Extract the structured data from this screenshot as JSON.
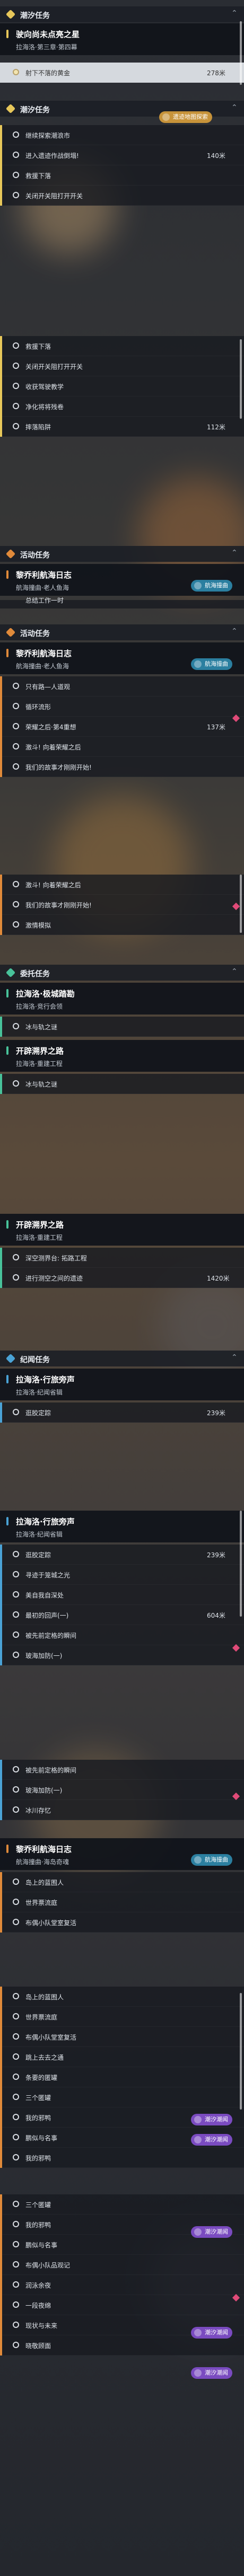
{
  "colors": {
    "tide": "#e7c75a",
    "event": "#e08a3a",
    "rich": "#48c29a",
    "legend": "#4aa3d6",
    "tag_navy": "#2b7fa0",
    "tag_purple": "#7a4bc0",
    "tag_gold": "#c7933a"
  },
  "icons": {
    "section": "diamond-icon",
    "quest": "circle-icon",
    "tag": "wave-icon",
    "chevron": "chevron-up-icon"
  },
  "sections": {
    "s1_tide": "潮汐任务",
    "s1_card_title": "驶向尚未点亮之星",
    "s1_card_sub": "拉海洛·第三章·第四幕",
    "s1_sel_label": "射下不落的黄金",
    "s1_sel_dist": "278米",
    "s2_hdr": "潮汐任务",
    "s2_tag": "遗迹地图探索",
    "s2_items": [
      {
        "label": "继续探索潮浪市",
        "dist": ""
      },
      {
        "label": "进入遗迹作战倒塌!",
        "dist": "140米"
      },
      {
        "label": "救援下落",
        "dist": ""
      },
      {
        "label": "关闭开关阻打开开关",
        "dist": ""
      }
    ],
    "s3_items": [
      {
        "label": "救援下落",
        "dist": ""
      },
      {
        "label": "关闭开关阻打开开关",
        "dist": ""
      },
      {
        "label": "收获驾驶教学",
        "dist": ""
      },
      {
        "label": "净化将将残卷",
        "dist": ""
      },
      {
        "label": "摔落陷阱",
        "dist": "112米"
      }
    ],
    "s4_hdr": "活动任务",
    "s4_card_title": "黎乔利航海日志",
    "s4_card_sub": "航海撞曲·老人鱼海",
    "s4_tag": "航海撞曲",
    "s4_partial": "总结工作一时",
    "s5_hdr": "活动任务",
    "s5_card_title": "黎乔利航海日志",
    "s5_card_sub": "航海撞曲·老人鱼海",
    "s5_tag": "航海撞曲",
    "s5_items": [
      {
        "label": "只有路—人道观",
        "dist": ""
      },
      {
        "label": "循环流形",
        "dist": ""
      },
      {
        "label": "荣耀之后·第4重想",
        "dist": "137米"
      },
      {
        "label": "激斗! 向着荣耀之后",
        "dist": ""
      },
      {
        "label": "我们的故事才刚刚开始!",
        "dist": ""
      }
    ],
    "s6_items": [
      {
        "label": "激斗! 向着荣耀之后",
        "dist": ""
      },
      {
        "label": "我们的故事才刚刚开始!",
        "dist": ""
      },
      {
        "label": "激情模拟",
        "dist": ""
      }
    ],
    "s7_hdr": "委托任务",
    "s7_card1_title": "拉海洛·极城踏勘",
    "s7_card1_sub": "拉海洛·竞行会领",
    "s7_items1": [
      {
        "label": "冰与轨之谜",
        "dist": ""
      }
    ],
    "s7_card2_title": "开辟溯界之路",
    "s7_card2_sub": "拉海洛·重建工程",
    "s7_items2": [
      {
        "label": "冰与轨之谜",
        "dist": ""
      }
    ],
    "s8_card_title": "开辟溯界之路",
    "s8_card_sub": "拉海洛·重建工程",
    "s8_items": [
      {
        "label": "深空测界台: 拓路工程",
        "dist": ""
      },
      {
        "label": "进行测空之间的遗迹",
        "dist": "1420米"
      }
    ],
    "s9_hdr": "纪闻任务",
    "s9_card_title": "拉海洛·行旅旁声",
    "s9_card_sub": "拉海洛·纪闻省辑",
    "s9_items": [
      {
        "label": "逛胶定踪",
        "dist": "239米"
      }
    ],
    "s10_card_title": "拉海洛·行旅旁声",
    "s10_card_sub": "拉海洛·纪闻省辑",
    "s10_items": [
      {
        "label": "逛胶定踪",
        "dist": "239米"
      },
      {
        "label": "寻迹于笼城之光",
        "dist": ""
      },
      {
        "label": "美自我自深处",
        "dist": ""
      },
      {
        "label": "最初的回声(一)",
        "dist": "604米"
      },
      {
        "label": "被先前定格的瞬间",
        "dist": ""
      },
      {
        "label": "玻海加防(一)",
        "dist": ""
      }
    ],
    "s11_items": [
      {
        "label": "被先前定格的瞬间",
        "dist": ""
      },
      {
        "label": "玻海加防(一)",
        "dist": ""
      },
      {
        "label": "冰川存忆",
        "dist": ""
      }
    ],
    "s12_card_title": "黎乔利航海日志",
    "s12_card_sub": "航海撞曲·海岛奇魂",
    "s12_tag": "航海撞曲",
    "s12_items": [
      {
        "label": "岛上的蓝囿人",
        "dist": ""
      },
      {
        "label": "世界票流庭",
        "dist": ""
      },
      {
        "label": "布偶小队堂室复活",
        "dist": ""
      }
    ],
    "s13_items": [
      {
        "label": "岛上的蓝囿人",
        "dist": ""
      },
      {
        "label": "世界票流庭",
        "dist": ""
      },
      {
        "label": "布偶小队堂室复活",
        "dist": ""
      },
      {
        "label": "跳上去去之通",
        "dist": ""
      },
      {
        "label": "条要的匿罐",
        "dist": ""
      },
      {
        "label": "三个匿罐",
        "dist": ""
      },
      {
        "label": "我的邪鸭",
        "dist": ""
      },
      {
        "label": "鹏似与名事",
        "dist": ""
      },
      {
        "label": "我的邪鸭",
        "dist": ""
      }
    ],
    "s13_tag": "潮汐潮闻",
    "s14_items": [
      {
        "label": "三个匿罐",
        "dist": ""
      },
      {
        "label": "我的邪鸭",
        "dist": ""
      },
      {
        "label": "鹏似与名事",
        "dist": ""
      },
      {
        "label": "布偶小队品观记",
        "dist": ""
      },
      {
        "label": "润泳余夜",
        "dist": ""
      },
      {
        "label": "一段夜绵",
        "dist": ""
      },
      {
        "label": "现状与未来",
        "dist": ""
      },
      {
        "label": "晓敬顾面",
        "dist": ""
      }
    ],
    "s14_tag": "潮汐潮闻"
  }
}
